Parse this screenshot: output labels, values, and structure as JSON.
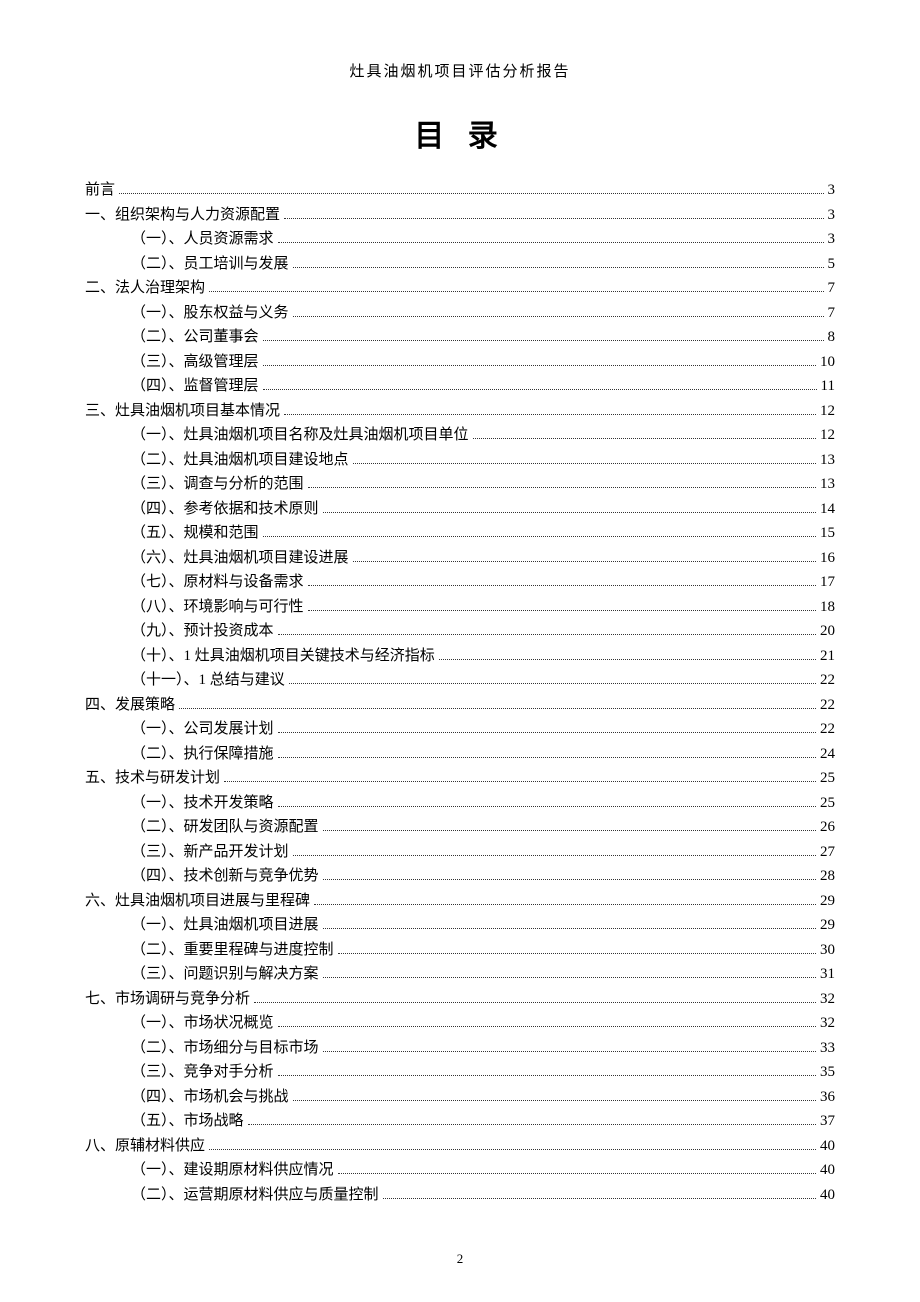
{
  "header": "灶具油烟机项目评估分析报告",
  "title": "目 录",
  "page_number": "2",
  "toc": [
    {
      "level": 0,
      "label": "前言",
      "page": "3"
    },
    {
      "level": 0,
      "label": "一、组织架构与人力资源配置",
      "page": "3"
    },
    {
      "level": 1,
      "label": "（一）、人员资源需求",
      "page": "3"
    },
    {
      "level": 1,
      "label": "（二）、员工培训与发展",
      "page": "5"
    },
    {
      "level": 0,
      "label": "二、法人治理架构",
      "page": "7"
    },
    {
      "level": 1,
      "label": "（一）、股东权益与义务",
      "page": "7"
    },
    {
      "level": 1,
      "label": "（二）、公司董事会",
      "page": "8"
    },
    {
      "level": 1,
      "label": "（三）、高级管理层",
      "page": "10"
    },
    {
      "level": 1,
      "label": "（四）、监督管理层",
      "page": "11"
    },
    {
      "level": 0,
      "label": "三、灶具油烟机项目基本情况",
      "page": "12"
    },
    {
      "level": 1,
      "label": "（一）、灶具油烟机项目名称及灶具油烟机项目单位",
      "page": "12"
    },
    {
      "level": 1,
      "label": "（二）、灶具油烟机项目建设地点",
      "page": "13"
    },
    {
      "level": 1,
      "label": "（三）、调查与分析的范围",
      "page": "13"
    },
    {
      "level": 1,
      "label": "（四）、参考依据和技术原则",
      "page": "14"
    },
    {
      "level": 1,
      "label": "（五）、规模和范围",
      "page": "15"
    },
    {
      "level": 1,
      "label": "（六）、灶具油烟机项目建设进展",
      "page": "16"
    },
    {
      "level": 1,
      "label": "（七）、原材料与设备需求",
      "page": "17"
    },
    {
      "level": 1,
      "label": "（八）、环境影响与可行性",
      "page": "18"
    },
    {
      "level": 1,
      "label": "（九）、预计投资成本",
      "page": "20"
    },
    {
      "level": 1,
      "label": "（十）、1 灶具油烟机项目关键技术与经济指标",
      "page": "21"
    },
    {
      "level": 1,
      "label": "（十一）、1 总结与建议",
      "page": "22"
    },
    {
      "level": 0,
      "label": "四、发展策略",
      "page": "22"
    },
    {
      "level": 1,
      "label": "（一）、公司发展计划",
      "page": "22"
    },
    {
      "level": 1,
      "label": "（二）、执行保障措施",
      "page": "24"
    },
    {
      "level": 0,
      "label": "五、技术与研发计划",
      "page": "25"
    },
    {
      "level": 1,
      "label": "（一）、技术开发策略",
      "page": "25"
    },
    {
      "level": 1,
      "label": "（二）、研发团队与资源配置",
      "page": "26"
    },
    {
      "level": 1,
      "label": "（三）、新产品开发计划",
      "page": "27"
    },
    {
      "level": 1,
      "label": "（四）、技术创新与竞争优势",
      "page": "28"
    },
    {
      "level": 0,
      "label": "六、灶具油烟机项目进展与里程碑",
      "page": "29"
    },
    {
      "level": 1,
      "label": "（一）、灶具油烟机项目进展",
      "page": "29"
    },
    {
      "level": 1,
      "label": "（二）、重要里程碑与进度控制",
      "page": "30"
    },
    {
      "level": 1,
      "label": "（三）、问题识别与解决方案",
      "page": "31"
    },
    {
      "level": 0,
      "label": "七、市场调研与竞争分析",
      "page": "32"
    },
    {
      "level": 1,
      "label": "（一）、市场状况概览",
      "page": "32"
    },
    {
      "level": 1,
      "label": "（二）、市场细分与目标市场",
      "page": "33"
    },
    {
      "level": 1,
      "label": "（三）、竞争对手分析",
      "page": "35"
    },
    {
      "level": 1,
      "label": "（四）、市场机会与挑战",
      "page": "36"
    },
    {
      "level": 1,
      "label": "（五）、市场战略",
      "page": "37"
    },
    {
      "level": 0,
      "label": "八、原辅材料供应",
      "page": "40"
    },
    {
      "level": 1,
      "label": "（一）、建设期原材料供应情况",
      "page": "40"
    },
    {
      "level": 1,
      "label": "（二）、运营期原材料供应与质量控制",
      "page": "40"
    }
  ]
}
